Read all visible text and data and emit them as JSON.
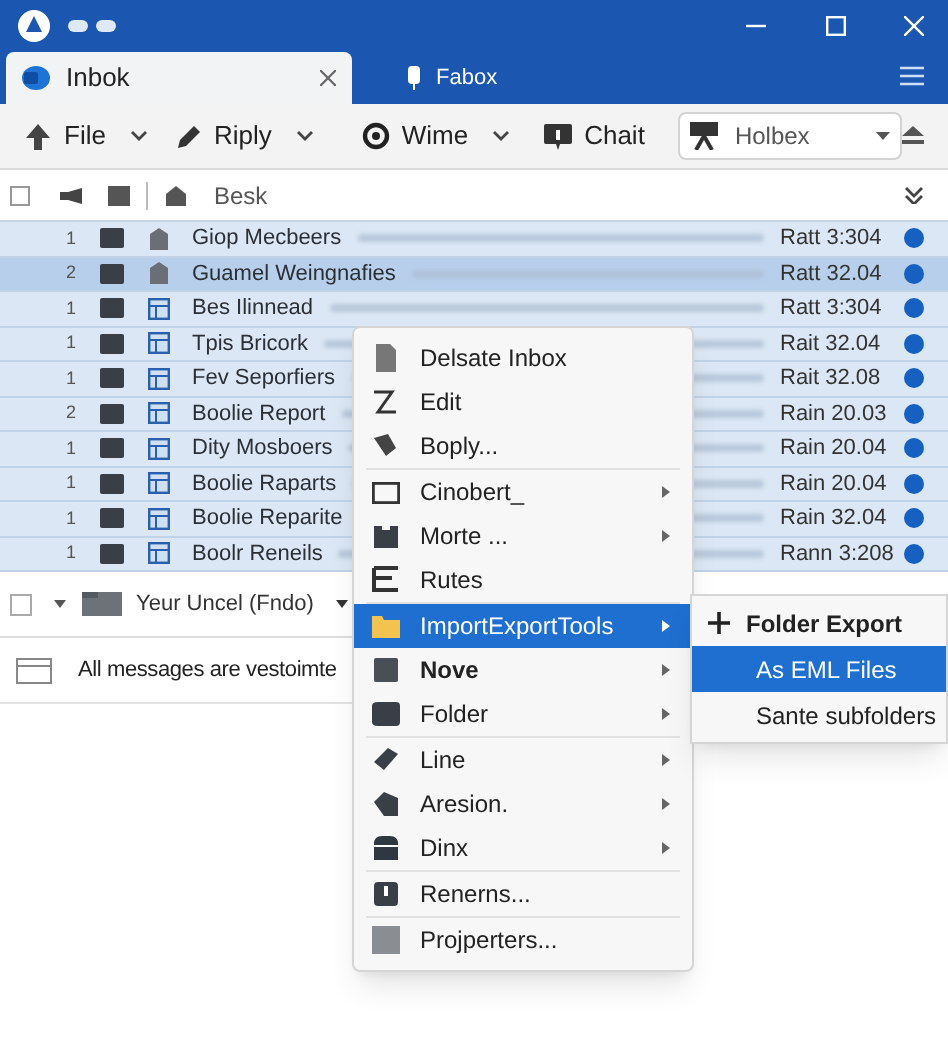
{
  "tabs": [
    {
      "label": "Inbok",
      "selected": true,
      "closable": true
    },
    {
      "label": "Fabox",
      "selected": false,
      "closable": false
    }
  ],
  "toolbar": {
    "buttons": [
      {
        "label": "File",
        "dropdown": true
      },
      {
        "label": "Riply",
        "dropdown": true
      },
      {
        "label": "Wime",
        "dropdown": true
      },
      {
        "label": "Chait",
        "dropdown": false
      }
    ],
    "folder_select": {
      "value": "Holbex"
    }
  },
  "list_header": {
    "label": "Besk",
    "checked": false
  },
  "messages": [
    {
      "count": "1",
      "subject": "Giop Mecbeers",
      "date": "Ratt 3:304",
      "selected": false
    },
    {
      "count": "2",
      "subject": "Guamel Weingnafies",
      "date": "Ratt 32.04",
      "selected": true
    },
    {
      "count": "1",
      "subject": "Bes Ilinnead",
      "date": "Ratt 3:304",
      "selected": false
    },
    {
      "count": "1",
      "subject": "Tpis Bricork",
      "date": "Rait 32.04",
      "selected": false
    },
    {
      "count": "1",
      "subject": "Fev Seporfiers",
      "date": "Rait 32.08",
      "selected": false
    },
    {
      "count": "2",
      "subject": "Boolie Report",
      "date": "Rain 20.03",
      "selected": false
    },
    {
      "count": "1",
      "subject": "Dity Mosboers",
      "date": "Rain 20.04",
      "selected": false
    },
    {
      "count": "1",
      "subject": "Boolie Raparts",
      "date": "Rain 20.04",
      "selected": false
    },
    {
      "count": "1",
      "subject": "Boolie Reparite",
      "date": "Rain 32.04",
      "selected": false
    },
    {
      "count": "1",
      "subject": "Boolr Reneils",
      "date": "Rann 3:208",
      "selected": false
    }
  ],
  "folder_row": {
    "label": "Yeur Uncel (Fndo)",
    "checked": false
  },
  "notice": "All messages are vestoimte",
  "context_menu": {
    "items": [
      {
        "label": "Delsate Inbox",
        "submenu": false,
        "selected": false,
        "bold": false
      },
      {
        "label": "Edit",
        "submenu": false,
        "selected": false,
        "bold": false
      },
      {
        "label": "Boply...",
        "submenu": false,
        "selected": false,
        "bold": false
      },
      {
        "label": "Cinobert_",
        "submenu": true,
        "selected": false,
        "bold": false
      },
      {
        "label": "Morte ...",
        "submenu": true,
        "selected": false,
        "bold": false
      },
      {
        "label": "Rutes",
        "submenu": false,
        "selected": false,
        "bold": false
      },
      {
        "label": "ImportExportTools",
        "submenu": true,
        "selected": true,
        "bold": false
      },
      {
        "label": "Nove",
        "submenu": true,
        "selected": false,
        "bold": true
      },
      {
        "label": "Folder",
        "submenu": true,
        "selected": false,
        "bold": false
      },
      {
        "label": "Line",
        "submenu": true,
        "selected": false,
        "bold": false
      },
      {
        "label": "Aresion.",
        "submenu": true,
        "selected": false,
        "bold": false
      },
      {
        "label": "Dinx",
        "submenu": true,
        "selected": false,
        "bold": false
      },
      {
        "label": "Renerns...",
        "submenu": false,
        "selected": false,
        "bold": false
      },
      {
        "label": "Projperters...",
        "submenu": false,
        "selected": false,
        "bold": false
      }
    ]
  },
  "submenu": {
    "items": [
      {
        "label": "Folder Export",
        "kind": "heading",
        "selected": false
      },
      {
        "label": "As EML Files",
        "kind": "item",
        "selected": true
      },
      {
        "label": "Sante subfolders",
        "kind": "item",
        "selected": false
      }
    ]
  }
}
